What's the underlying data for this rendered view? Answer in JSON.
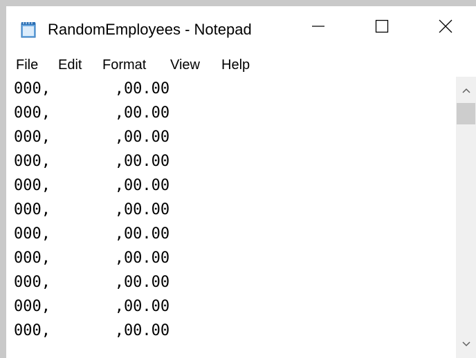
{
  "window": {
    "title": "RandomEmployees - Notepad",
    "app_icon": "notepad-icon"
  },
  "caption_buttons": {
    "minimize_icon": "minimize-icon",
    "maximize_icon": "maximize-icon",
    "close_icon": "close-icon"
  },
  "menu": {
    "items": [
      {
        "label": "File"
      },
      {
        "label": "Edit"
      },
      {
        "label": "Format"
      },
      {
        "label": "View"
      },
      {
        "label": "Help"
      }
    ]
  },
  "editor": {
    "lines": [
      "000,       ,00.00",
      "000,       ,00.00",
      "000,       ,00.00",
      "000,       ,00.00",
      "000,       ,00.00",
      "000,       ,00.00",
      "000,       ,00.00",
      "000,       ,00.00",
      "000,       ,00.00",
      "000,       ,00.00",
      "000,       ,00.00"
    ]
  },
  "scrollbar": {
    "up_icon": "scroll-up-arrow-icon",
    "down_icon": "scroll-down-arrow-icon"
  },
  "colors": {
    "background": "#ffffff",
    "frame": "#c9c9c9",
    "scrollbar_track": "#f0f0f0",
    "scrollbar_thumb": "#cdcdcd",
    "text": "#000000"
  }
}
